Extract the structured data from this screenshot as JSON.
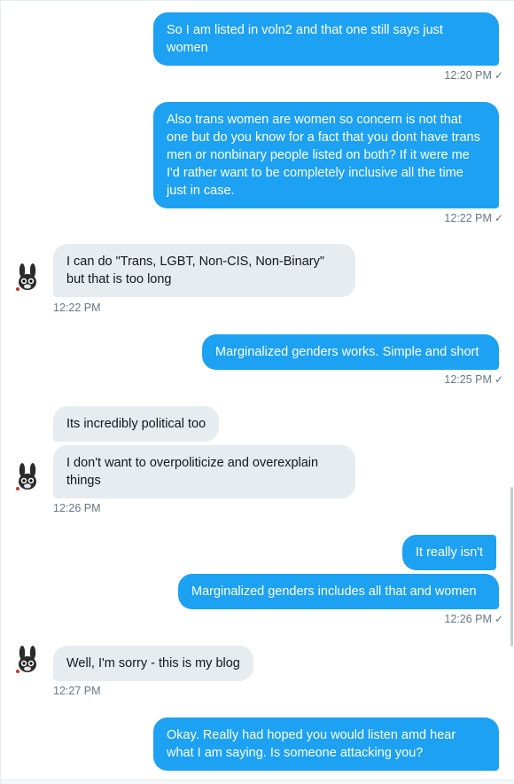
{
  "conversation": {
    "messages": [
      {
        "id": "m1",
        "side": "sent",
        "text": "So I am listed in voln2 and that one still says just women",
        "time": "12:20 PM"
      },
      {
        "id": "m2",
        "side": "sent",
        "text": "Also trans women are women so concern is not that one but do you know for a fact that you dont have trans men or nonbinary people listed on both? If it were me I'd rather want to be completely inclusive all the time just in case.",
        "time": "12:22 PM"
      },
      {
        "id": "m3",
        "side": "recv",
        "text": "I can do \"Trans, LGBT, Non-CIS, Non-Binary\" but that is too long",
        "time": "12:22 PM"
      },
      {
        "id": "m4",
        "side": "sent",
        "text": "Marginalized genders works. Simple and short",
        "time": "12:25 PM"
      },
      {
        "id": "m5",
        "side": "recv",
        "text": "Its incredibly political too",
        "time": ""
      },
      {
        "id": "m6",
        "side": "recv",
        "text": "I don't want to overpoliticize and overexplain things",
        "time": "12:26 PM"
      },
      {
        "id": "m7",
        "side": "sent",
        "text": "It really isn't",
        "time": ""
      },
      {
        "id": "m8",
        "side": "sent",
        "text": "Marginalized genders includes all that and women",
        "time": "12:26 PM"
      },
      {
        "id": "m9",
        "side": "recv",
        "text": "Well, I'm sorry - this is my blog",
        "time": "12:27 PM"
      },
      {
        "id": "m10",
        "side": "sent",
        "text": "Okay. Really had hoped you would listen amd hear what I am saying. Is someone attacking you?",
        "time": ""
      }
    ],
    "read_receipt": "✓",
    "avatar_icon": "bunny-avatar-icon"
  },
  "colors": {
    "sent_bubble": "#1da1f2",
    "recv_bubble": "#e6ecf0",
    "meta_text": "#657786"
  }
}
